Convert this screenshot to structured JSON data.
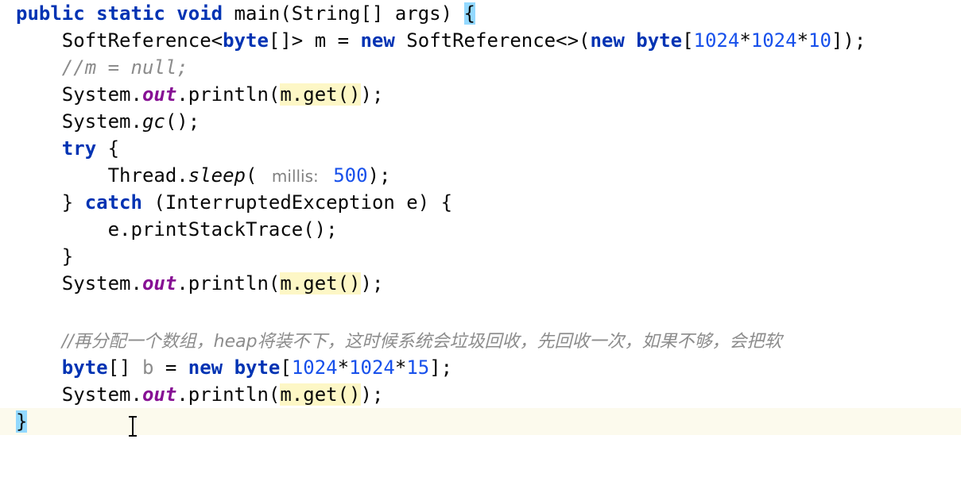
{
  "editor": {
    "lines": [
      {
        "kw1": "public static void",
        "t1": " main(String[] args) ",
        "brace": "{"
      },
      {
        "t1": "SoftReference<",
        "kw1": "byte",
        "t2": "[]> m = ",
        "kw2": "new",
        "t3": " SoftReference<>(",
        "kw3": "new byte",
        "t4": "[",
        "n1": "1024",
        "t5": "*",
        "n2": "1024",
        "t6": "*",
        "n3": "10",
        "t7": "]);"
      },
      {
        "comment": "//m = null;"
      },
      {
        "t1": "System.",
        "field": "out",
        "t2": ".println(",
        "hl": "m.get()",
        "t3": ");"
      },
      {
        "t1": "System.",
        "method": "gc",
        "t2": "();"
      },
      {
        "kw1": "try",
        "t1": " {"
      },
      {
        "t1": "Thread.",
        "method": "sleep",
        "t2": "( ",
        "hint": "millis:",
        "t3": " ",
        "n1": "500",
        "t4": ");"
      },
      {
        "t1": "} ",
        "kw1": "catch",
        "t2": " (InterruptedException e) {"
      },
      {
        "t1": "e.printStackTrace();"
      },
      {
        "t1": "}"
      },
      {
        "t1": "System.",
        "field": "out",
        "t2": ".println(",
        "hl": "m.get()",
        "t3": ");"
      },
      {
        "comment": "//再分配一个数组，heap将装不下，这时候系统会垃圾回收，先回收一次，如果不够，会把软"
      },
      {
        "kw1": "byte",
        "t1": "[] ",
        "unused": "b",
        "t2": " = ",
        "kw2": "new byte",
        "t3": "[",
        "n1": "1024",
        "t4": "*",
        "n2": "1024",
        "t5": "*",
        "n3": "15",
        "t6": "];"
      },
      {
        "t1": "System.",
        "field": "out",
        "t2": ".println(",
        "hl": "m.get()",
        "t3": ");"
      },
      {
        "brace": "}"
      }
    ]
  },
  "colors": {
    "keyword": "#0033b3",
    "number": "#1750eb",
    "comment": "#8c8c8c",
    "static_field": "#871094",
    "usage_highlight": "#fdf7c6",
    "brace_match": "#93d9ff",
    "caret_row": "#fcfaed"
  },
  "icons": {
    "mouse_cursor": "text-cursor-icon"
  }
}
